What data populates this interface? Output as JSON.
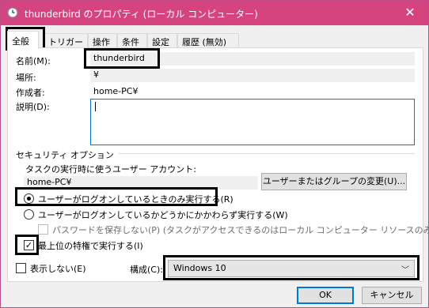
{
  "window": {
    "title": "thunderbird のプロパティ (ローカル コンピューター)",
    "close_glyph": "✕"
  },
  "tabs": [
    {
      "label": "全般",
      "active": true
    },
    {
      "label": "トリガー",
      "active": false
    },
    {
      "label": "操作",
      "active": false
    },
    {
      "label": "条件",
      "active": false
    },
    {
      "label": "設定",
      "active": false
    },
    {
      "label": "履歴 (無効)",
      "active": false
    }
  ],
  "general": {
    "name_label": "名前(M):",
    "name_value": "thunderbird",
    "location_label": "場所:",
    "location_value": "¥",
    "author_label": "作成者:",
    "author_value": "home-PC¥",
    "description_label": "説明(D):",
    "description_value": ""
  },
  "security": {
    "group_label": "セキュリティ オプション",
    "account_prompt": "タスクの実行時に使うユーザー アカウント:",
    "account_value": "home-PC¥",
    "change_button": "ユーザーまたはグループの変更(U)...",
    "radio_logon_only": "ユーザーがログオンしているときのみ実行する(R)",
    "radio_logon_any": "ユーザーがログオンしているかどうかにかかわらず実行する(W)",
    "radio_selected": "logon_only",
    "no_store_password": "パスワードを保存しない(P) (タスクがアクセスできるのはローカル コンピューター リソースのみ)",
    "highest_privileges": "最上位の特権で実行する(I)",
    "highest_privileges_checked": true
  },
  "footer": {
    "hidden_label": "表示しない(E)",
    "hidden_checked": false,
    "configure_label": "構成(C):",
    "configure_value": "Windows 10",
    "ok_button": "OK",
    "cancel_button": "キャンセル"
  },
  "colors": {
    "titlebar": "#d5447f",
    "focus_border": "#0078d7"
  }
}
